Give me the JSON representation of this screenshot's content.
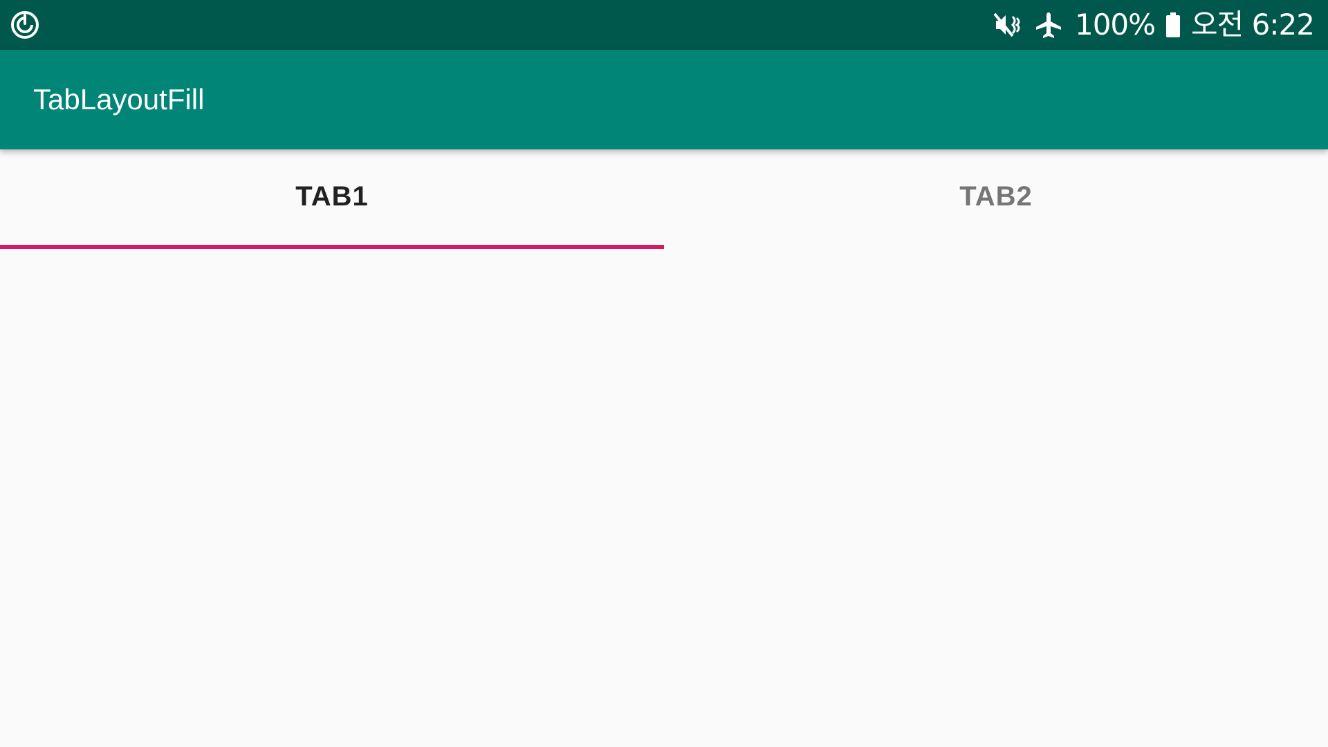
{
  "status_bar": {
    "left_icon": "sync-circle-icon",
    "icons": [
      "vibrate-mute-icon",
      "airplane-icon",
      "battery-icon"
    ],
    "battery_percent": "100%",
    "time": "오전 6:22"
  },
  "app_bar": {
    "title": "TabLayoutFill"
  },
  "tabs": [
    {
      "label": "TAB1",
      "selected": true
    },
    {
      "label": "TAB2",
      "selected": false
    }
  ],
  "colors": {
    "status_bar": "#00574B",
    "app_bar": "#008577",
    "indicator": "#D81B60",
    "background": "#FAFAFA"
  }
}
